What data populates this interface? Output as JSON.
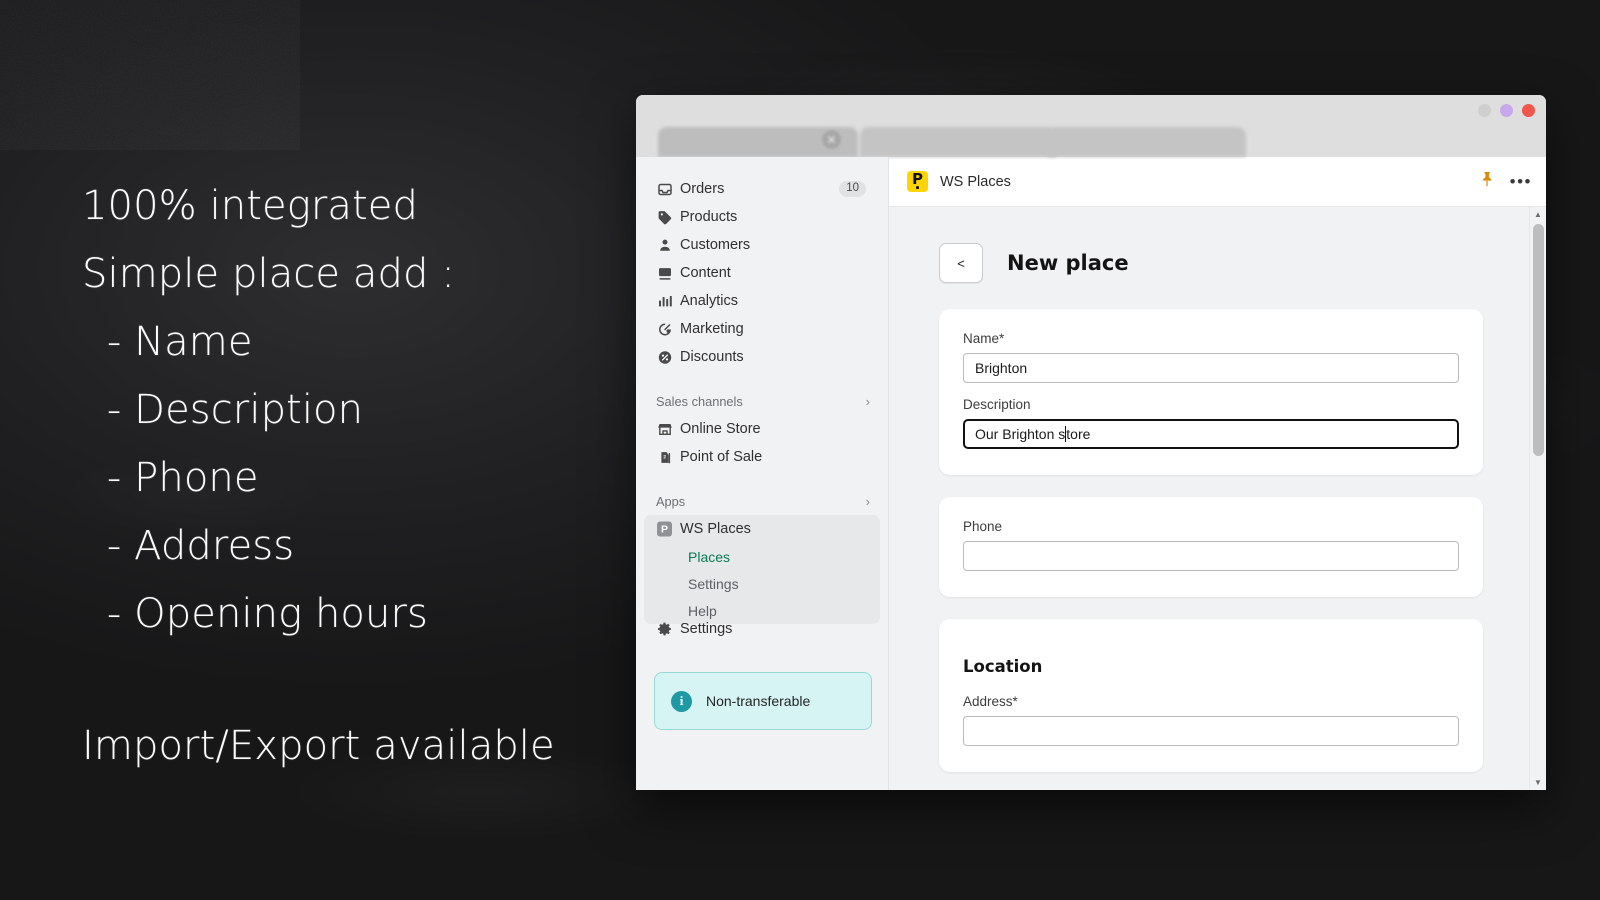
{
  "chalkboard": {
    "lines": [
      {
        "text": "100% integrated",
        "indent": false
      },
      {
        "text": "Simple place add :",
        "indent": false
      },
      {
        "text": " - Name",
        "indent": true
      },
      {
        "text": " - Description",
        "indent": true
      },
      {
        "text": " - Phone",
        "indent": true
      },
      {
        "text": " - Address",
        "indent": true
      },
      {
        "text": " - Opening hours",
        "indent": true
      }
    ],
    "footer": "Import/Export available"
  },
  "window": {
    "dots": [
      {
        "name": "minimize",
        "color": "#cfcfcf"
      },
      {
        "name": "maximize",
        "color": "#c9a7ec"
      },
      {
        "name": "close",
        "color": "#f0564a"
      }
    ],
    "tab_close_glyph": "✕"
  },
  "sidebar": {
    "items": [
      {
        "label": "Orders",
        "icon": "inbox-icon",
        "glyph": "▤",
        "badge": "10"
      },
      {
        "label": "Products",
        "icon": "tag-icon",
        "glyph": "🏷",
        "badge": ""
      },
      {
        "label": "Customers",
        "icon": "person-icon",
        "glyph": "👤",
        "badge": ""
      },
      {
        "label": "Content",
        "icon": "image-icon",
        "glyph": "🖼",
        "badge": ""
      },
      {
        "label": "Analytics",
        "icon": "bar-chart-icon",
        "glyph": "📊",
        "badge": ""
      },
      {
        "label": "Marketing",
        "icon": "megaphone-icon",
        "glyph": "◎",
        "badge": ""
      },
      {
        "label": "Discounts",
        "icon": "discount-icon",
        "glyph": "%",
        "badge": ""
      }
    ],
    "sales_channels": {
      "header": "Sales channels",
      "chevron": "›",
      "items": [
        {
          "label": "Online Store",
          "icon": "store-icon",
          "glyph": "🏪"
        },
        {
          "label": "Point of Sale",
          "icon": "pos-icon",
          "glyph": "🛍"
        }
      ]
    },
    "apps": {
      "header": "Apps",
      "chevron": "›",
      "app_name": "WS Places",
      "app_icon_letter": "P",
      "sub_items": [
        {
          "label": "Places",
          "active": true
        },
        {
          "label": "Settings",
          "active": false
        },
        {
          "label": "Help",
          "active": false
        }
      ]
    },
    "settings": {
      "label": "Settings",
      "icon": "gear-icon",
      "glyph": "⚙"
    },
    "banner": {
      "text": "Non-transferable",
      "icon": "info-icon",
      "glyph": "i",
      "bg_color": "#d6f4f4",
      "border_color": "#9ad8d8",
      "icon_color": "#1f9aa5"
    },
    "active_accent_color": "#0b7a52"
  },
  "app_header": {
    "title": "WS Places",
    "icon_letter": "P",
    "icon_bg": "#ffd400",
    "pin_icon": "pin-icon",
    "pin_glyph": "📌",
    "menu_glyph": "•••"
  },
  "page": {
    "back_label": "<",
    "title": "New place",
    "cards": [
      {
        "name": "details-card",
        "heading": "",
        "fields": [
          {
            "label": "Name*",
            "value": "Brighton",
            "placeholder": "",
            "focused": false,
            "name": "name-input"
          },
          {
            "label": "Description",
            "value": "Our Brighton store",
            "placeholder": "",
            "focused": true,
            "name": "description-input"
          }
        ]
      },
      {
        "name": "phone-card",
        "heading": "",
        "fields": [
          {
            "label": "Phone",
            "value": "",
            "placeholder": "",
            "focused": false,
            "name": "phone-input"
          }
        ]
      },
      {
        "name": "location-card",
        "heading": "Location",
        "fields": [
          {
            "label": "Address*",
            "value": "",
            "placeholder": "",
            "focused": false,
            "name": "address-input"
          }
        ]
      }
    ]
  },
  "scrollbar": {
    "up_glyph": "▲",
    "down_glyph": "▼"
  }
}
